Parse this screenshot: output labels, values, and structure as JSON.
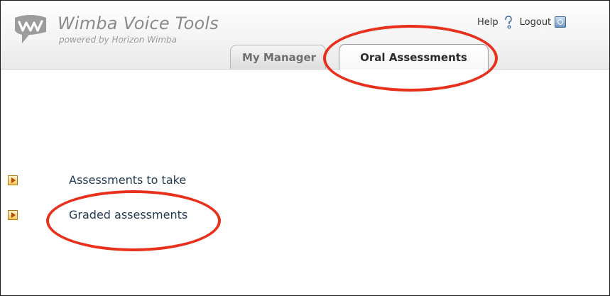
{
  "header": {
    "logo_title": "Wimba Voice Tools",
    "logo_subtitle": "powered by Horizon Wimba",
    "help_label": "Help",
    "logout_label": "Logout"
  },
  "tabs": [
    {
      "label": "My Manager",
      "active": false
    },
    {
      "label": "Oral Assessments",
      "active": true
    }
  ],
  "menu": {
    "items": [
      {
        "label": "Assessments to take",
        "icon": "orange-arrow-icon"
      },
      {
        "label": "Graded assessments",
        "icon": "orange-arrow-icon"
      }
    ]
  },
  "colors": {
    "annotation": "#e8301c",
    "link_text": "#233a52",
    "logo_text": "#8a8a8a"
  }
}
